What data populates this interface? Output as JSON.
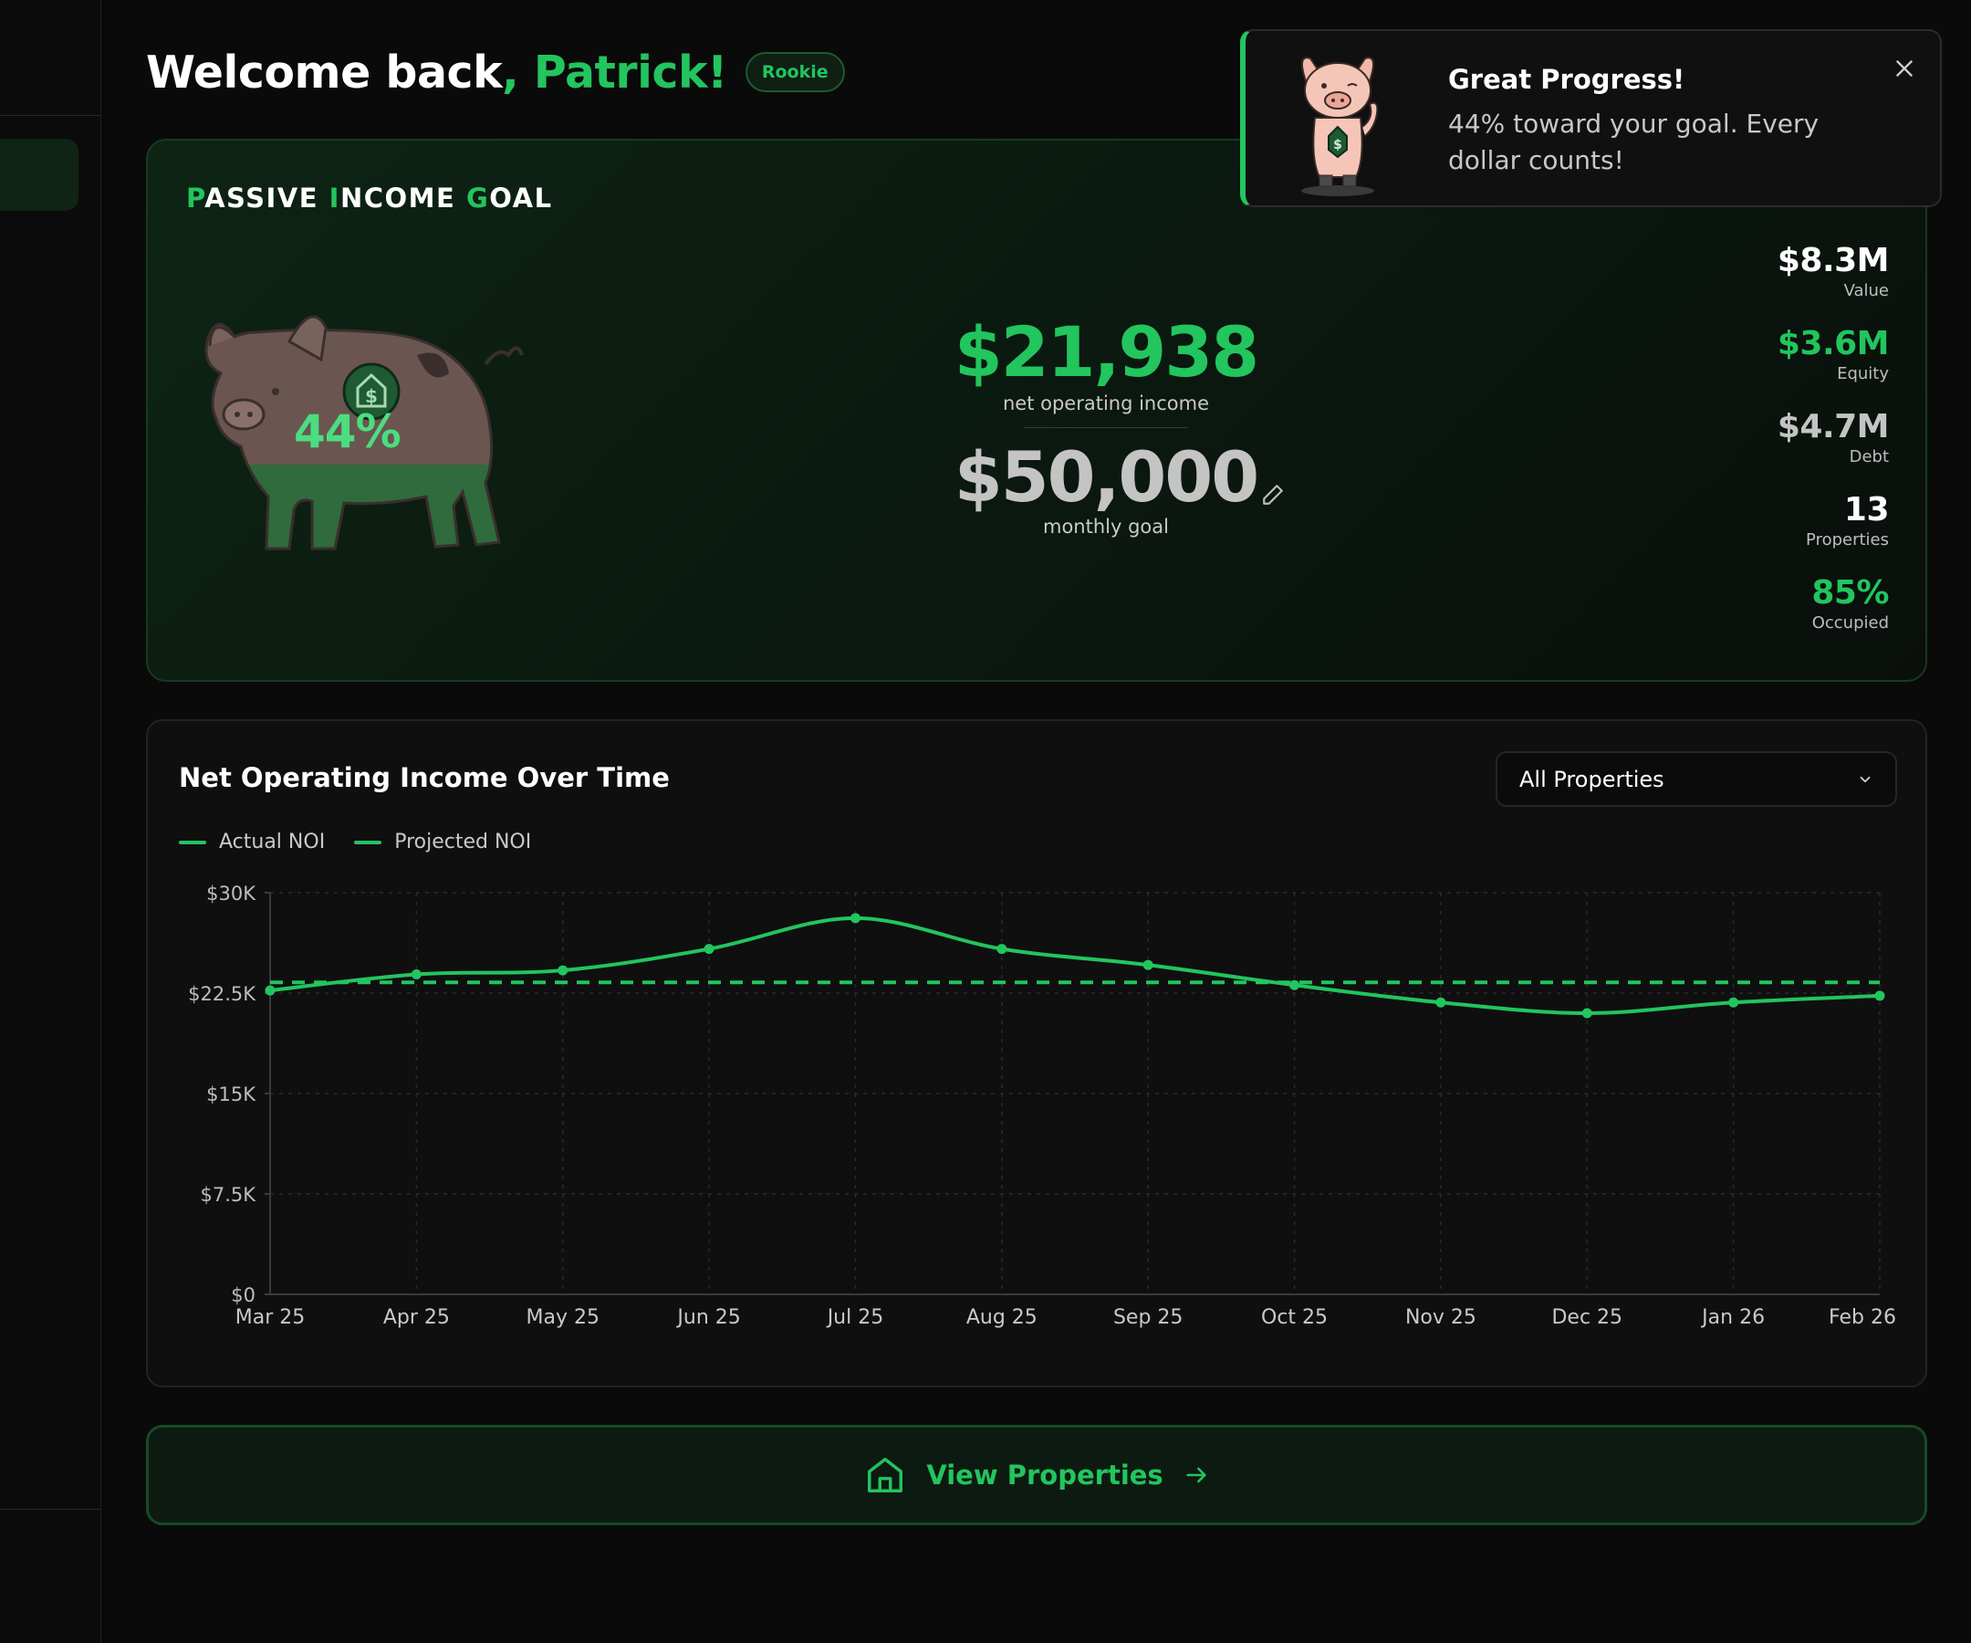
{
  "header": {
    "welcome_prefix": "Welcome back",
    "welcome_name": ", Patrick!",
    "badge": "Rookie"
  },
  "goal_card": {
    "title_parts": [
      "P",
      "ASSIVE ",
      "I",
      "NCOME ",
      "G",
      "OAL"
    ],
    "progress_percent": "44%",
    "progress_fraction": 0.44,
    "noi_value": "$21,938",
    "noi_label": "net operating income",
    "goal_value": "$50,000",
    "goal_label": "monthly goal",
    "stats": [
      {
        "value": "$8.3M",
        "label": "Value",
        "color": "#ffffff"
      },
      {
        "value": "$3.6M",
        "label": "Equity",
        "color": "#22c55e"
      },
      {
        "value": "$4.7M",
        "label": "Debt",
        "color": "#c4c4c4"
      },
      {
        "value": "13",
        "label": "Properties",
        "color": "#ffffff"
      },
      {
        "value": "85%",
        "label": "Occupied",
        "color": "#22c55e"
      }
    ]
  },
  "toast": {
    "title": "Great Progress!",
    "message": "44% toward your goal. Every dollar counts!",
    "icons": [
      "pig-mascot-icon",
      "close-icon"
    ]
  },
  "chart_section": {
    "title": "Net Operating Income Over Time",
    "filter_value": "All Properties",
    "legend": [
      "Actual NOI",
      "Projected NOI"
    ]
  },
  "chart_data": {
    "type": "line",
    "categories": [
      "Mar 25",
      "Apr 25",
      "May 25",
      "Jun 25",
      "Jul 25",
      "Aug 25",
      "Sep 25",
      "Oct 25",
      "Nov 25",
      "Dec 25",
      "Jan 26",
      "Feb 26"
    ],
    "series": [
      {
        "name": "Actual NOI",
        "style": "solid",
        "values": [
          22700,
          23900,
          24200,
          25800,
          28100,
          25800,
          24600,
          23100,
          21800,
          21000,
          21800,
          22300
        ]
      },
      {
        "name": "Projected NOI",
        "style": "dashed",
        "values": [
          23300,
          23300,
          23300,
          23300,
          23300,
          23300,
          23300,
          23300,
          23300,
          23300,
          23300,
          23300
        ]
      }
    ],
    "y_ticks": [
      "$0",
      "$7.5K",
      "$15K",
      "$22.5K",
      "$30K"
    ],
    "ylim": [
      0,
      30000
    ],
    "grid": true,
    "color": "#22c55e"
  },
  "view_button": {
    "label": "View Properties"
  },
  "colors": {
    "accent": "#22c55e",
    "background": "#0a0a0a",
    "card": "#0f0f0f"
  }
}
